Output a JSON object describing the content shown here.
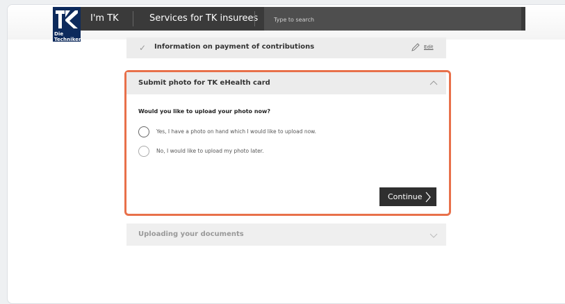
{
  "header": {
    "logo_text": "Die\nTechniker",
    "nav_im_tk": "I'm TK",
    "nav_services": "Services for TK insurees",
    "search_placeholder": "Type to search"
  },
  "steps": {
    "completed": {
      "title": "Information on payment of contributions",
      "edit_label": "Edit"
    },
    "active": {
      "title": "Submit photo for TK eHealth card",
      "question": "Would you like to upload your photo now?",
      "options": [
        "Yes, I have a photo on hand which I would like to upload now.",
        "No, I would like to upload my photo later."
      ],
      "continue_label": "Continue"
    },
    "next": {
      "title": "Uploading your documents"
    }
  },
  "colors": {
    "highlight": "#e8704a",
    "brand_blue": "#0d2a5c",
    "header_dark": "#3a3a3a"
  },
  "icons": [
    "tk-logo-icon",
    "search-icon",
    "check-icon",
    "pencil-icon",
    "chevron-up-icon",
    "chevron-right-icon",
    "chevron-down-icon"
  ]
}
